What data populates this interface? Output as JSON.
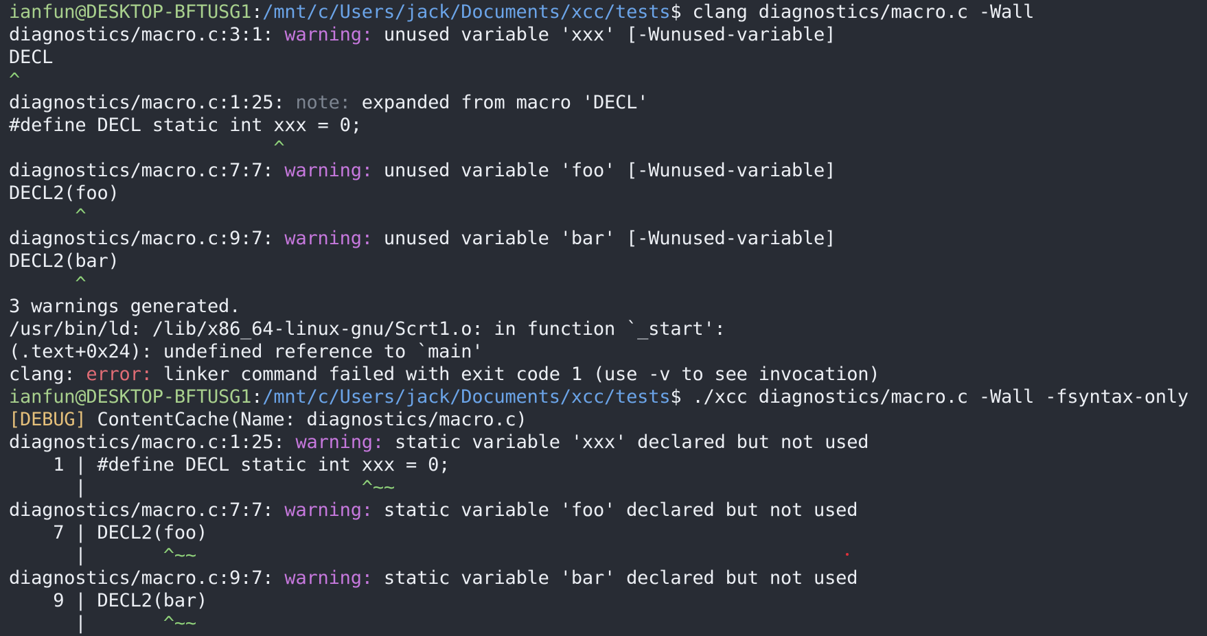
{
  "colors": {
    "background": "#282c34",
    "user": "#a8d08d",
    "path": "#6ba4e8",
    "warning": "#c678dd",
    "note": "#7d8591",
    "error": "#e06c75",
    "debug": "#e5c07b",
    "caret": "#8fd17a",
    "text": "#eceff4"
  },
  "lines": [
    [
      {
        "t": "ianfun@DESKTOP-BFTUSG1",
        "c": "user"
      },
      {
        "t": ":",
        "c": "text"
      },
      {
        "t": "/mnt/c/Users/jack/Documents/xcc/tests",
        "c": "path"
      },
      {
        "t": "$ clang diagnostics/macro.c -Wall",
        "c": "text"
      }
    ],
    [
      {
        "t": "diagnostics/macro.c:3:1: ",
        "c": "text"
      },
      {
        "t": "warning:",
        "c": "warn"
      },
      {
        "t": " unused variable 'xxx' [-Wunused-variable]",
        "c": "text"
      }
    ],
    [
      {
        "t": "DECL",
        "c": "text"
      }
    ],
    [
      {
        "t": "^",
        "c": "caret"
      }
    ],
    [
      {
        "t": "diagnostics/macro.c:1:25: ",
        "c": "text"
      },
      {
        "t": "note:",
        "c": "note"
      },
      {
        "t": " expanded from macro 'DECL'",
        "c": "text"
      }
    ],
    [
      {
        "t": "#define DECL static int xxx = 0;",
        "c": "text"
      }
    ],
    [
      {
        "t": "                        ^",
        "c": "caret"
      }
    ],
    [
      {
        "t": "diagnostics/macro.c:7:7: ",
        "c": "text"
      },
      {
        "t": "warning:",
        "c": "warn"
      },
      {
        "t": " unused variable 'foo' [-Wunused-variable]",
        "c": "text"
      }
    ],
    [
      {
        "t": "DECL2(foo)",
        "c": "text"
      }
    ],
    [
      {
        "t": "      ^",
        "c": "caret"
      }
    ],
    [
      {
        "t": "diagnostics/macro.c:9:7: ",
        "c": "text"
      },
      {
        "t": "warning:",
        "c": "warn"
      },
      {
        "t": " unused variable 'bar' [-Wunused-variable]",
        "c": "text"
      }
    ],
    [
      {
        "t": "DECL2(bar)",
        "c": "text"
      }
    ],
    [
      {
        "t": "      ^",
        "c": "caret"
      }
    ],
    [
      {
        "t": "3 warnings generated.",
        "c": "text"
      }
    ],
    [
      {
        "t": "/usr/bin/ld: /lib/x86_64-linux-gnu/Scrt1.o: in function `_start':",
        "c": "text"
      }
    ],
    [
      {
        "t": "(.text+0x24): undefined reference to `main'",
        "c": "text"
      }
    ],
    [
      {
        "t": "clang: ",
        "c": "text"
      },
      {
        "t": "error:",
        "c": "err"
      },
      {
        "t": " linker command failed with exit code 1 (use -v to see invocation)",
        "c": "text"
      }
    ],
    [
      {
        "t": "ianfun@DESKTOP-BFTUSG1",
        "c": "user"
      },
      {
        "t": ":",
        "c": "text"
      },
      {
        "t": "/mnt/c/Users/jack/Documents/xcc/tests",
        "c": "path"
      },
      {
        "t": "$ ./xcc diagnostics/macro.c -Wall -fsyntax-only",
        "c": "text"
      }
    ],
    [
      {
        "t": "[DEBUG]",
        "c": "debug"
      },
      {
        "t": " ContentCache(Name: diagnostics/macro.c)",
        "c": "text"
      }
    ],
    [
      {
        "t": "diagnostics/macro.c:1:25: ",
        "c": "text"
      },
      {
        "t": "warning:",
        "c": "warn"
      },
      {
        "t": " static variable 'xxx' declared but not used",
        "c": "text"
      }
    ],
    [
      {
        "t": "    1 | #define DECL static int xxx = 0;",
        "c": "text"
      }
    ],
    [
      {
        "t": "      |                         ",
        "c": "text"
      },
      {
        "t": "^~~",
        "c": "caret"
      }
    ],
    [
      {
        "t": "diagnostics/macro.c:7:7: ",
        "c": "text"
      },
      {
        "t": "warning:",
        "c": "warn"
      },
      {
        "t": " static variable 'foo' declared but not used",
        "c": "text"
      }
    ],
    [
      {
        "t": "    7 | DECL2(foo)",
        "c": "text"
      }
    ],
    [
      {
        "t": "      |       ",
        "c": "text"
      },
      {
        "t": "^~~",
        "c": "caret"
      }
    ],
    [
      {
        "t": "diagnostics/macro.c:9:7: ",
        "c": "text"
      },
      {
        "t": "warning:",
        "c": "warn"
      },
      {
        "t": " static variable 'bar' declared but not used",
        "c": "text"
      }
    ],
    [
      {
        "t": "    9 | DECL2(bar)",
        "c": "text"
      }
    ],
    [
      {
        "t": "      |       ",
        "c": "text"
      },
      {
        "t": "^~~",
        "c": "caret"
      }
    ]
  ]
}
